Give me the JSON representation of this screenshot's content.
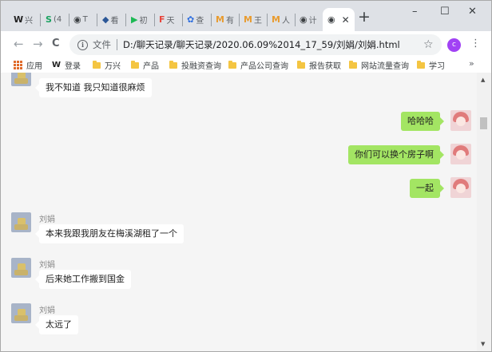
{
  "window": {
    "minimize_icon": "minimize-icon",
    "maximize_icon": "maximize-icon",
    "close_icon": "close-icon",
    "minimize_glyph": "–",
    "maximize_glyph": "☐",
    "close_glyph": "✕"
  },
  "tabs": [
    {
      "icon": "W",
      "label": "兴",
      "color": "#222222"
    },
    {
      "icon": "S",
      "label": "(4",
      "color": "#1aa260"
    },
    {
      "icon": "◉",
      "label": "T",
      "color": "#3c4043"
    },
    {
      "icon": "◆",
      "label": "看",
      "color": "#2b5797"
    },
    {
      "icon": "▶",
      "label": "初",
      "color": "#1db954"
    },
    {
      "icon": "F",
      "label": "天",
      "color": "#e8453c"
    },
    {
      "icon": "✿",
      "label": "查",
      "color": "#2f6fdf"
    },
    {
      "icon": "M",
      "label": "有",
      "color": "#e89b2f"
    },
    {
      "icon": "M",
      "label": "王",
      "color": "#e89b2f"
    },
    {
      "icon": "M",
      "label": "人",
      "color": "#e89b2f"
    },
    {
      "icon": "◉",
      "label": "计",
      "color": "#3c4043"
    }
  ],
  "active_tab": {
    "icon": "◉",
    "close": "✕"
  },
  "new_tab": "+",
  "toolbar": {
    "back": "←",
    "forward": "→",
    "reload": "C",
    "info": "i",
    "file_label": "文件",
    "url": "D:/聊天记录/聊天记录/2020.06.09%2014_17_59/刘娟/刘娟.html",
    "star": "☆",
    "profile_initial": "c",
    "menu": "⋮"
  },
  "bookmarks": {
    "apps_label": "应用",
    "login_label": "登录",
    "folders": [
      "万兴",
      "产品",
      "投融资查询",
      "产品公司查询",
      "报告获取",
      "网站流量查询",
      "学习"
    ],
    "more": "»"
  },
  "messages": [
    {
      "side": "left",
      "name": "",
      "text": "我不知道 我只知道很麻烦"
    },
    {
      "side": "right",
      "text": "哈哈哈"
    },
    {
      "side": "right",
      "text": "你们可以换个房子啊"
    },
    {
      "side": "right",
      "text": "一起"
    },
    {
      "side": "left",
      "name": "刘娟",
      "text": "本来我跟我朋友在梅溪湖租了一个"
    },
    {
      "side": "left",
      "name": "刘娟",
      "text": "后来她工作搬到国金"
    },
    {
      "side": "left",
      "name": "刘娟",
      "text": "太远了"
    }
  ],
  "colors": {
    "bubble_right": "#a3e563",
    "bubble_left": "#ffffff",
    "chat_bg": "#f5f5f5",
    "tabstrip": "#dee1e6"
  },
  "scrollbar": {
    "up": "▲",
    "down": "▼"
  }
}
